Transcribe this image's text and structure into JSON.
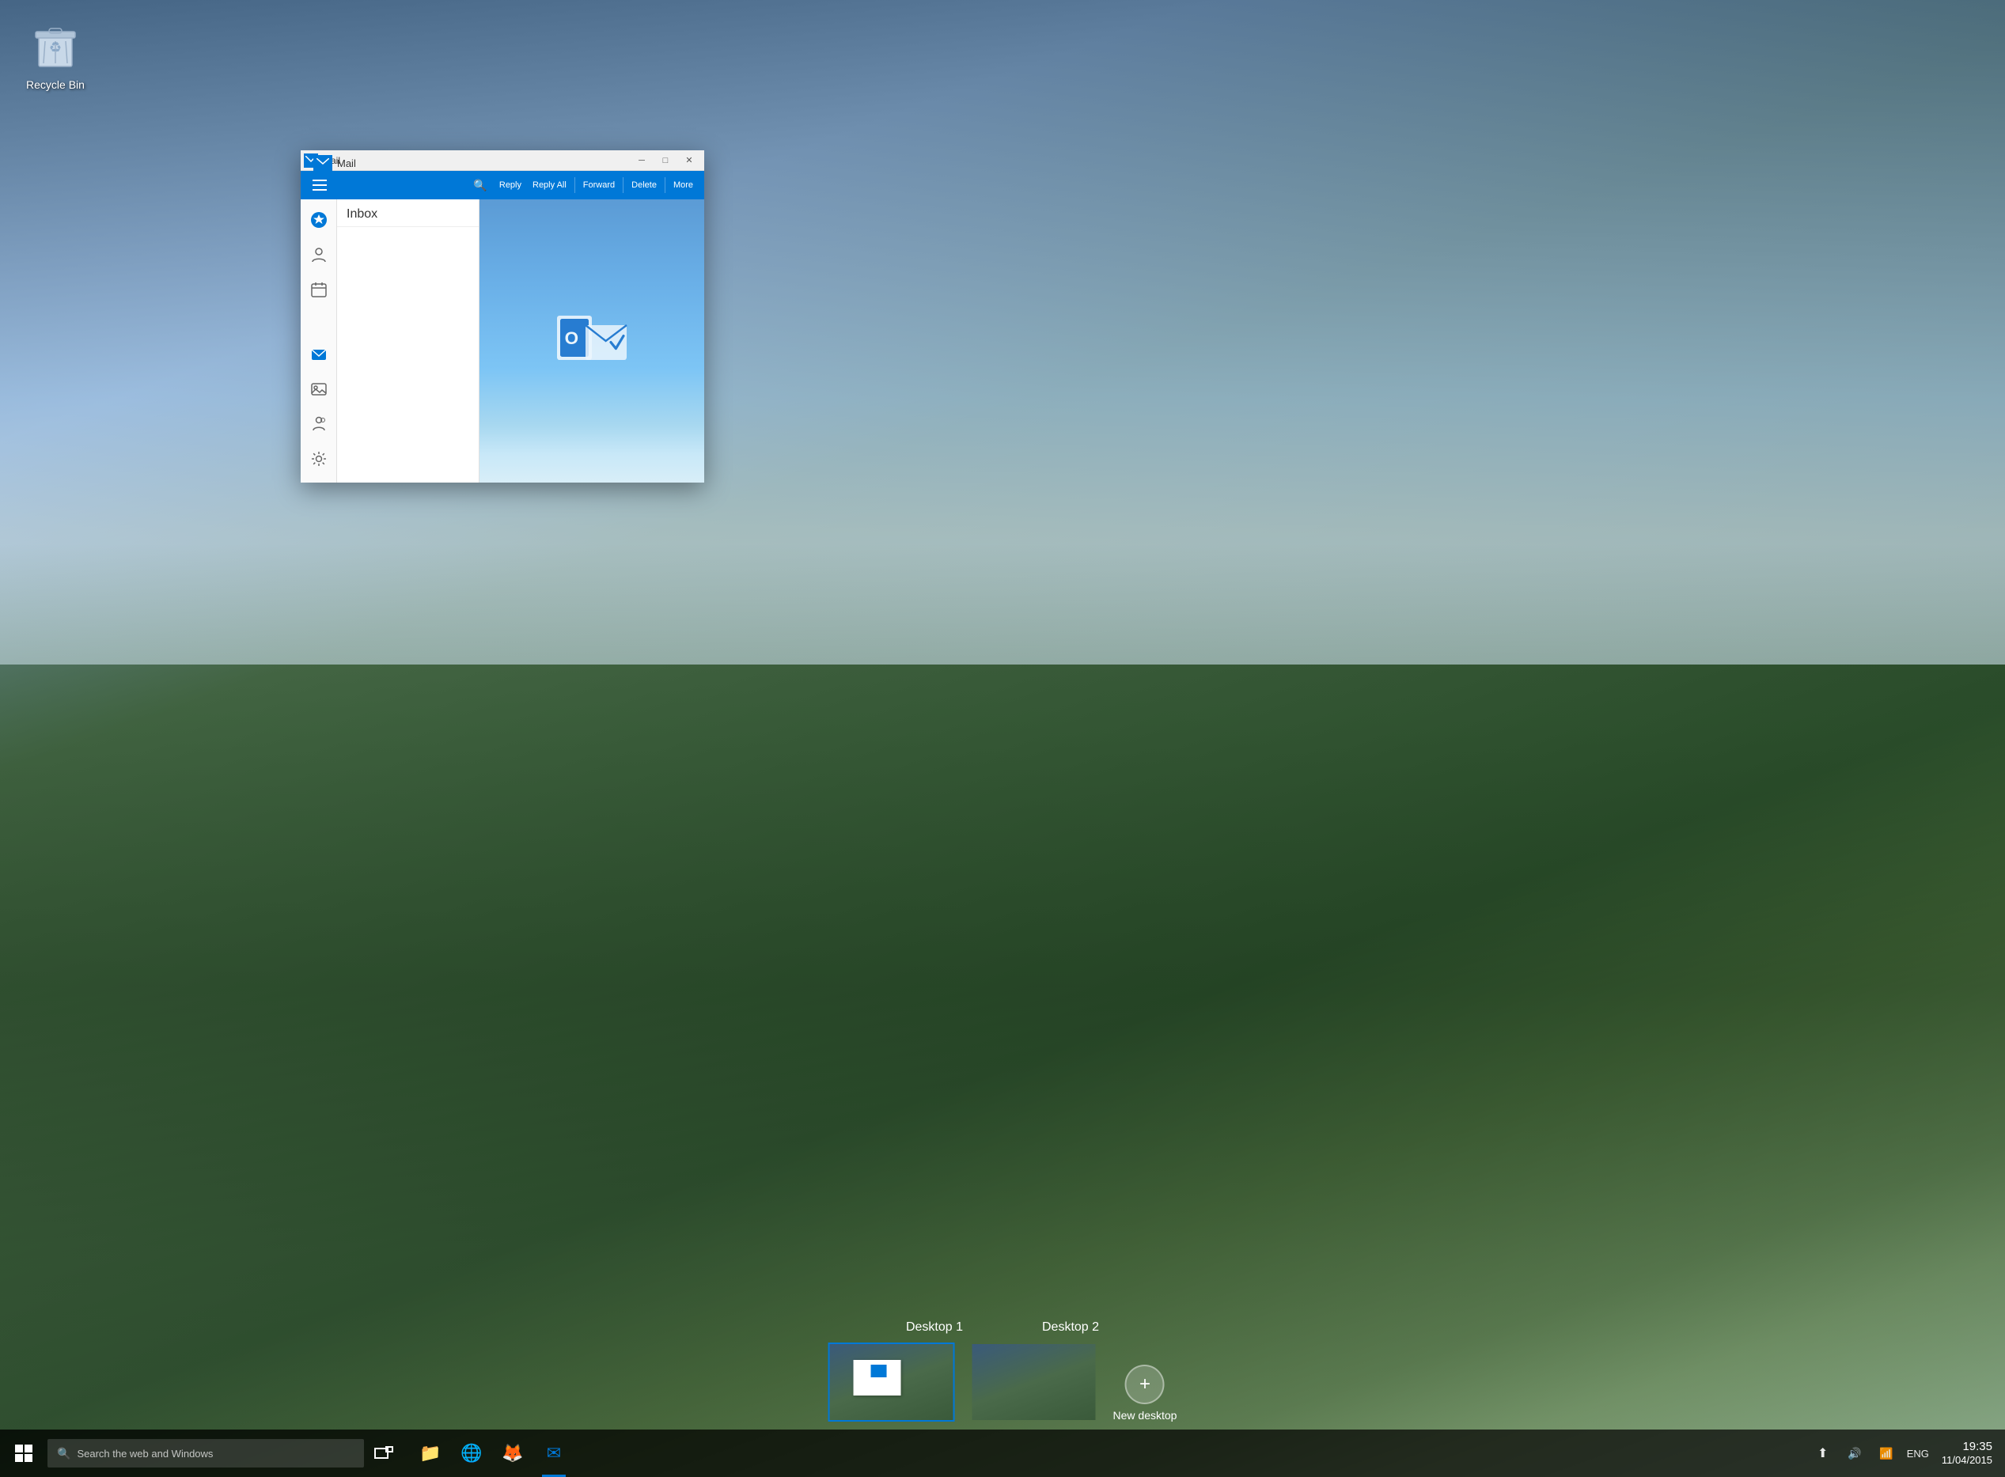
{
  "desktop": {
    "recycle_bin_label": "Recycle Bin"
  },
  "mail_window": {
    "floating_title": "Mail",
    "window_title": "Mail",
    "toolbar": {
      "reply_label": "Reply",
      "reply_all_label": "Reply All",
      "forward_label": "Forward",
      "delete_label": "Delete",
      "more_label": "More"
    },
    "sidebar": {
      "inbox_label": "Inbox"
    }
  },
  "virtual_desktops": {
    "desktop1_label": "Desktop 1",
    "desktop2_label": "Desktop 2",
    "new_desktop_label": "New desktop",
    "new_desktop_plus": "+"
  },
  "taskbar": {
    "search_placeholder": "Search the web and Windows",
    "time": "19:35",
    "date": "11/04/2015",
    "lang": "ENG"
  }
}
